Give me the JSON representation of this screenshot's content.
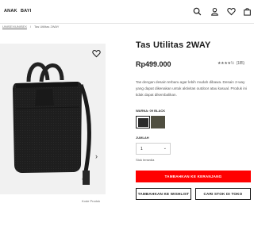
{
  "nav": {
    "anak": "ANAK",
    "bayi": "BAYI"
  },
  "icons": {
    "search": "search-icon",
    "account": "user-icon",
    "wishlist": "heart-icon",
    "cart": "bag-icon"
  },
  "breadcrumb": {
    "parent": "UNISEX/UNISEX",
    "separator": "/",
    "current": "Tas Utilitas 2WAY"
  },
  "product": {
    "title": "Tas Utilitas 2WAY",
    "price": "Rp499.000",
    "rating_stars": "★★★★½",
    "rating_value": 4.5,
    "review_count": "(185)",
    "description": "Tas dengan desain terbaru agar lebih mudah dibawa. Desain 2-way yang dapat dikenakan untuk aktivitas outdoor atau kasual. Produk ini tidak dapat dikembalikan.",
    "code_label": "Kode Produk"
  },
  "color": {
    "label": "WARNA: 09 BLACK",
    "swatches": [
      "#2b2b2b",
      "#4f4e40"
    ]
  },
  "quantity": {
    "label": "JUMLAH",
    "value": "1"
  },
  "stock_status": "Stok tersedia",
  "buttons": {
    "add_to_cart": "TAMBAHKAN KE KERANJANG",
    "add_to_wishlist": "TAMBAHKAN KE WISHLIST",
    "find_store": "CARI STOK DI TOKO"
  },
  "colors": {
    "accent": "#ff0000",
    "text": "#1b1b1b"
  }
}
